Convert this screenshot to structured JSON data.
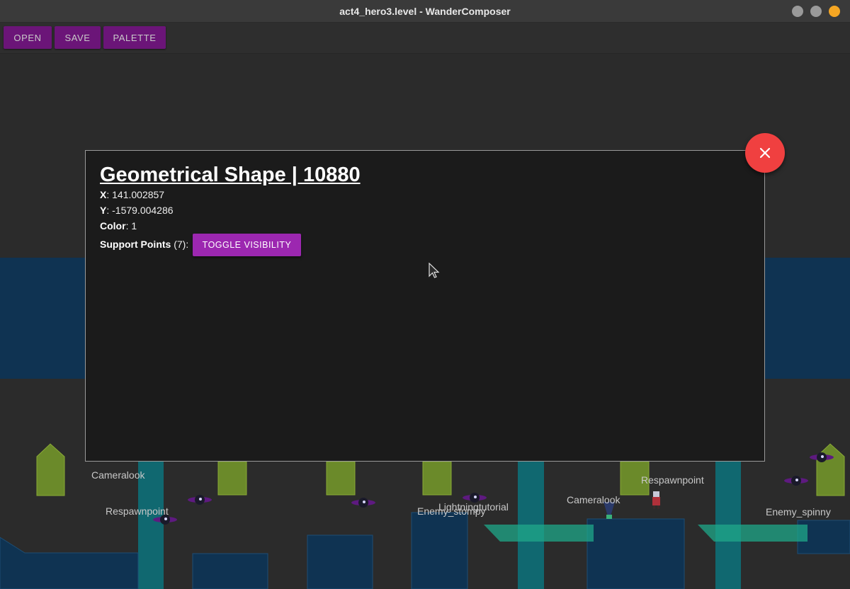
{
  "window": {
    "title": "act4_hero3.level - WanderComposer"
  },
  "toolbar": {
    "open_label": "OPEN",
    "save_label": "SAVE",
    "palette_label": "PALETTE"
  },
  "dialog": {
    "heading": "Geometrical Shape | 10880",
    "x_label": "X",
    "x_value": ": 141.002857",
    "y_label": "Y",
    "y_value": ": -1579.004286",
    "color_label": "Color",
    "color_value": ": 1",
    "support_label": "Support Points",
    "support_value": " (7):",
    "toggle_label": "TOGGLE VISIBILITY"
  },
  "map_labels": {
    "cameralook_1": "Cameralook",
    "respawnpoint_1": "Respawnpoint",
    "enemy_stompy": "Enemy_stompy",
    "lightningtutorial": "Lightningtutorial",
    "cameralook_2": "Cameralook",
    "respawnpoint_2": "Respawnpoint",
    "enemy_spinny": "Enemy_spinny"
  },
  "icons": {
    "close": "close-icon",
    "cursor": "mouse-cursor-icon"
  },
  "colors": {
    "accent": "#9c27b0",
    "toolbar_button": "#6b1578",
    "close_button": "#f04040",
    "water_blue": "#0f3352",
    "platform_green": "#6b8a2a",
    "teal_beam": "#0d6f78"
  }
}
